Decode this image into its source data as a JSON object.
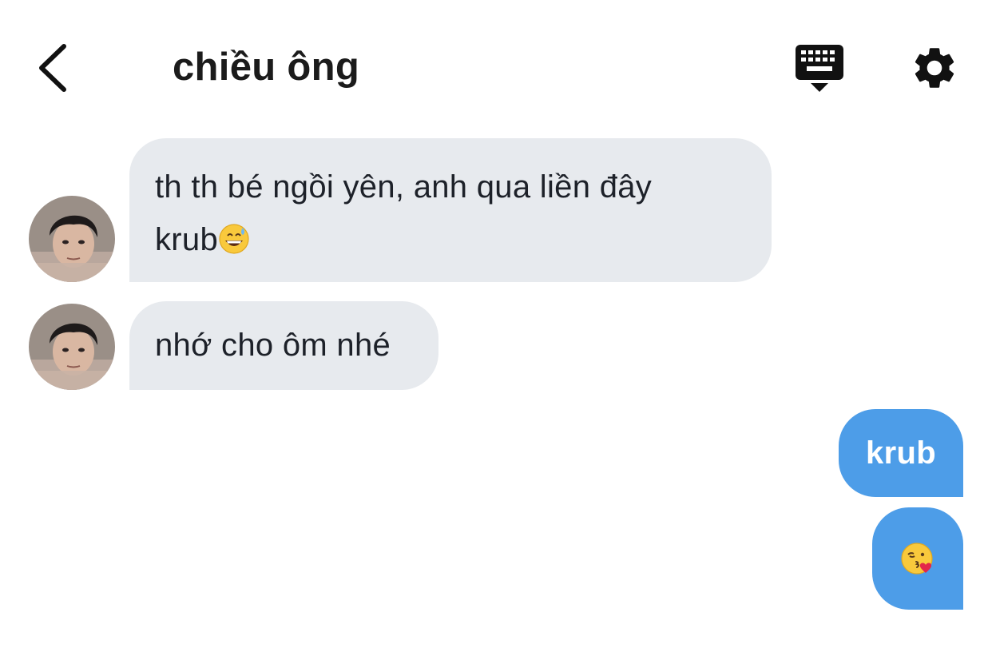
{
  "header": {
    "back_icon": "chevron-left-icon",
    "title": "chiều ông",
    "keyboard_icon": "keyboard-hide-icon",
    "settings_icon": "gear-icon"
  },
  "messages": [
    {
      "direction": "incoming",
      "sender_avatar": "contact-photo",
      "text_lines": [
        "th th bé ngồi yên, anh qua liền đây",
        "krub"
      ],
      "trailing_emoji": "grinning-face-with-sweat"
    },
    {
      "direction": "incoming",
      "sender_avatar": "contact-photo",
      "text": "nhớ cho ôm nhé"
    },
    {
      "direction": "outgoing",
      "text": "krub"
    },
    {
      "direction": "outgoing",
      "emoji": "face-blowing-a-kiss"
    }
  ],
  "colors": {
    "incoming_bubble": "#e7eaee",
    "outgoing_bubble": "#4d9de8",
    "outgoing_text": "#ffffff",
    "title_text": "#1b1b1b"
  }
}
